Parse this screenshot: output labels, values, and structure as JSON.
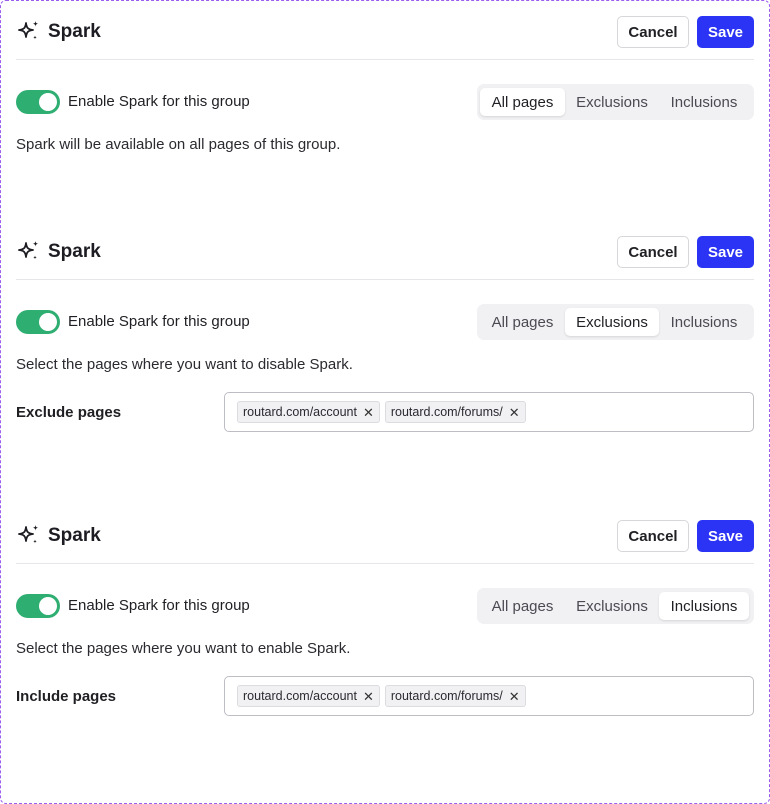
{
  "panels": [
    {
      "title": "Spark",
      "cancel_label": "Cancel",
      "save_label": "Save",
      "toggle_label": "Enable Spark for this group",
      "toggle_on": true,
      "tabs": [
        "All pages",
        "Exclusions",
        "Inclusions"
      ],
      "active_tab": "All pages",
      "description": "Spark will be available on all pages of this group."
    },
    {
      "title": "Spark",
      "cancel_label": "Cancel",
      "save_label": "Save",
      "toggle_label": "Enable Spark for this group",
      "toggle_on": true,
      "tabs": [
        "All pages",
        "Exclusions",
        "Inclusions"
      ],
      "active_tab": "Exclusions",
      "description": "Select the pages where you want to disable Spark.",
      "field_label": "Exclude pages",
      "tags": [
        "routard.com/account",
        "routard.com/forums/"
      ]
    },
    {
      "title": "Spark",
      "cancel_label": "Cancel",
      "save_label": "Save",
      "toggle_label": "Enable Spark for this group",
      "toggle_on": true,
      "tabs": [
        "All pages",
        "Exclusions",
        "Inclusions"
      ],
      "active_tab": "Inclusions",
      "description": "Select the pages where you want to enable Spark.",
      "field_label": "Include pages",
      "tags": [
        "routard.com/account",
        "routard.com/forums/"
      ]
    }
  ],
  "icons": {
    "title_icon": "sparkle-icon",
    "tag_remove_icon": "close-icon",
    "tag_remove_glyph": "✕"
  },
  "colors": {
    "primary": "#2b34f5",
    "toggle_on": "#2fae72",
    "frame_border": "#9b5cf0"
  }
}
